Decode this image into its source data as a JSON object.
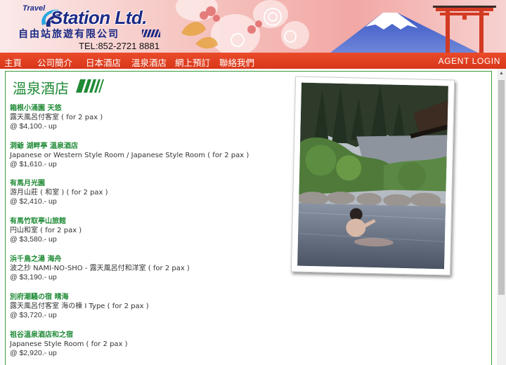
{
  "header": {
    "logo_travel": "Travel",
    "logo_main": "Station Ltd.",
    "logo_cn": "自由站旅遊有限公司",
    "tel": "TEL:852-2721 8881"
  },
  "nav": {
    "items": [
      {
        "label": "主頁"
      },
      {
        "label": "公司簡介"
      },
      {
        "label": "日本酒店"
      },
      {
        "label": "溫泉酒店"
      },
      {
        "label": "網上預訂"
      },
      {
        "label": "聯絡我們"
      }
    ],
    "login_label": "AGENT LOGIN"
  },
  "colors": {
    "nav_red": "#d83719",
    "accent_green": "#1f8a35",
    "logo_navy": "#1b2a86"
  },
  "main": {
    "title": "溫泉酒店",
    "hotels": [
      {
        "name": "箱根小涌園 天悠",
        "room": "露天風呂付客室 ( for 2 pax )",
        "price": "@ $4,100.- up"
      },
      {
        "name": "洞爺 湖畔亭 溫泉酒店",
        "room": "Japanese or Western Style Room / Japanese Style Room ( for 2 pax )",
        "price": "@ $1,610.- up"
      },
      {
        "name": "有馬月光園",
        "room": "游月山莊 ( 和室 ) ( for 2 pax )",
        "price": "@ $2,410.- up"
      },
      {
        "name": "有馬竹取亭山旅館",
        "room": "円山和室 ( for 2 pax )",
        "price": "@ $3,580.- up"
      },
      {
        "name": "浜千鳥之湯 海舟",
        "room": "波之抄 NAMI-NO-SHO - 露天風呂付和洋室 ( for 2 pax )",
        "price": "@ $3,190.- up"
      },
      {
        "name": "別府潮騷の宿 晴海",
        "room": "露天風呂付客室 海の棟 I Type ( for 2 pax )",
        "price": "@ $3,720.- up"
      },
      {
        "name": "祖谷溫泉酒店和之宿",
        "room": "Japanese Style Room ( for 2 pax )",
        "price": "@ $2,920.- up"
      }
    ]
  },
  "icons": {
    "logo": "station-logo-swoosh-icon",
    "scroll_up": "scroll-up-arrow-icon",
    "title_decoration": "green-stripes-icon"
  }
}
